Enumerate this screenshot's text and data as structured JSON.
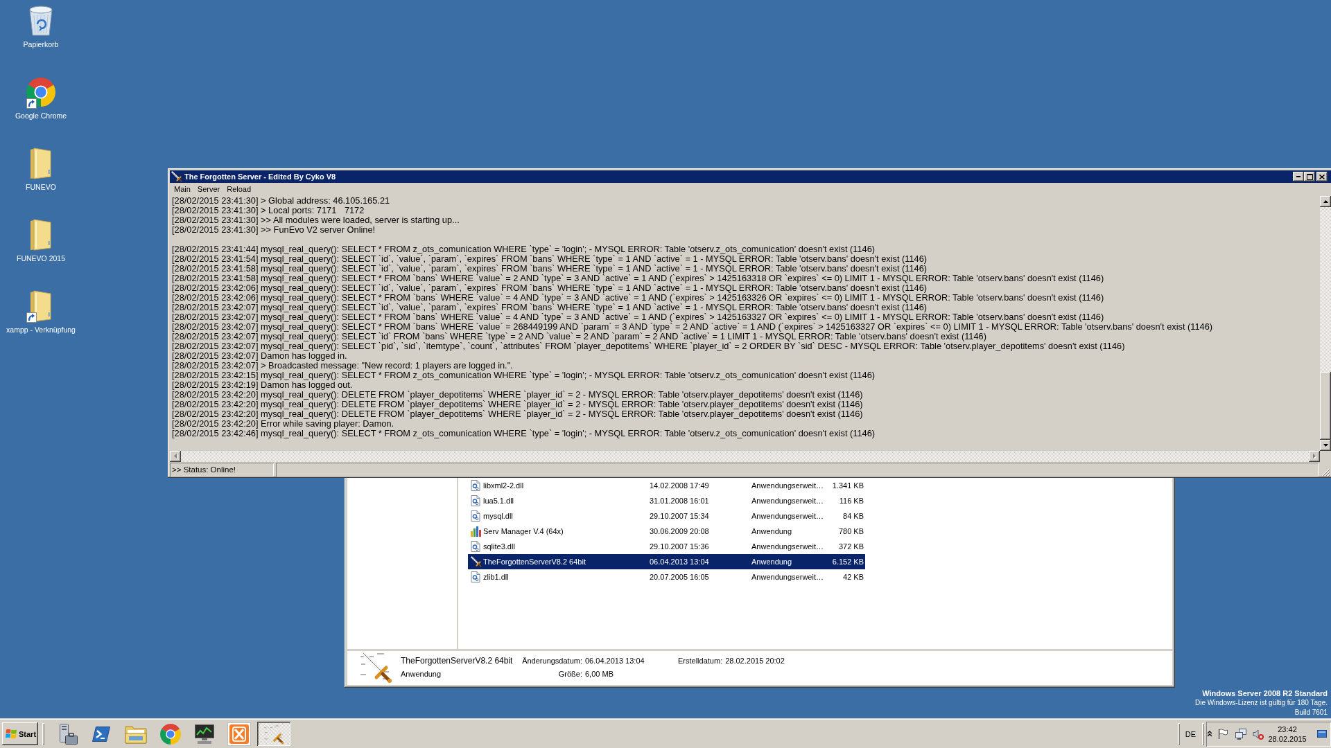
{
  "desktop": {
    "icons": [
      {
        "label": "Papierkorb",
        "kind": "recycle-bin",
        "shortcut": false
      },
      {
        "label": "Google Chrome",
        "kind": "browser",
        "shortcut": true
      },
      {
        "label": "FUNEVO",
        "kind": "folder",
        "shortcut": false
      },
      {
        "label": "FUNEVO 2015",
        "kind": "folder",
        "shortcut": false
      },
      {
        "label": "xampp - Verknüpfung",
        "kind": "folder",
        "shortcut": true
      }
    ]
  },
  "server_window": {
    "title": "The Forgotten Server - Edited By Cyko V8",
    "menu": [
      "Main",
      "Server",
      "Reload"
    ],
    "log": [
      [
        "[28/02/2015 23:41:30] > Global address: 46.105.165.21",
        "[28/02/2015 23:41:30] > Local ports: 7171\t7172",
        "[28/02/2015 23:41:30] >> All modules were loaded, server is starting up...",
        "[28/02/2015 23:41:30] >> FunEvo V2 server Online!"
      ],
      [
        "[28/02/2015 23:41:44] mysql_real_query(): SELECT * FROM z_ots_comunication WHERE `type` = 'login'; - MYSQL ERROR: Table 'otserv.z_ots_comunication' doesn't exist (1146)",
        "[28/02/2015 23:41:54] mysql_real_query(): SELECT `id`, `value`, `param`, `expires` FROM `bans` WHERE `type` = 1 AND `active` = 1 - MYSQL ERROR: Table 'otserv.bans' doesn't exist (1146)",
        "[28/02/2015 23:41:58] mysql_real_query(): SELECT `id`, `value`, `param`, `expires` FROM `bans` WHERE `type` = 1 AND `active` = 1 - MYSQL ERROR: Table 'otserv.bans' doesn't exist (1146)",
        "[28/02/2015 23:41:58] mysql_real_query(): SELECT * FROM `bans` WHERE `value` = 2 AND `type` = 3 AND `active` = 1 AND (`expires` > 1425163318 OR `expires` <= 0) LIMIT 1 - MYSQL ERROR: Table 'otserv.bans' doesn't exist (1146)",
        "[28/02/2015 23:42:06] mysql_real_query(): SELECT `id`, `value`, `param`, `expires` FROM `bans` WHERE `type` = 1 AND `active` = 1 - MYSQL ERROR: Table 'otserv.bans' doesn't exist (1146)",
        "[28/02/2015 23:42:06] mysql_real_query(): SELECT * FROM `bans` WHERE `value` = 4 AND `type` = 3 AND `active` = 1 AND (`expires` > 1425163326 OR `expires` <= 0) LIMIT 1 - MYSQL ERROR: Table 'otserv.bans' doesn't exist (1146)",
        "[28/02/2015 23:42:07] mysql_real_query(): SELECT `id`, `value`, `param`, `expires` FROM `bans` WHERE `type` = 1 AND `active` = 1 - MYSQL ERROR: Table 'otserv.bans' doesn't exist (1146)",
        "[28/02/2015 23:42:07] mysql_real_query(): SELECT * FROM `bans` WHERE `value` = 4 AND `type` = 3 AND `active` = 1 AND (`expires` > 1425163327 OR `expires` <= 0) LIMIT 1 - MYSQL ERROR: Table 'otserv.bans' doesn't exist (1146)",
        "[28/02/2015 23:42:07] mysql_real_query(): SELECT * FROM `bans` WHERE `value` = 268449199 AND `param` = 3 AND `type` = 2 AND `active` = 1 AND (`expires` > 1425163327 OR `expires` <= 0) LIMIT 1 - MYSQL ERROR: Table 'otserv.bans' doesn't exist (1146)",
        "[28/02/2015 23:42:07] mysql_real_query(): SELECT `id` FROM `bans` WHERE `type` = 2 AND `value` = 2 AND `param` = 2 AND `active` = 1 LIMIT 1 - MYSQL ERROR: Table 'otserv.bans' doesn't exist (1146)",
        "[28/02/2015 23:42:07] mysql_real_query(): SELECT `pid`, `sid`, `itemtype`, `count`, `attributes` FROM `player_depotitems` WHERE `player_id` = 2 ORDER BY `sid` DESC - MYSQL ERROR: Table 'otserv.player_depotitems' doesn't exist (1146)",
        "[28/02/2015 23:42:07] Damon has logged in.",
        "[28/02/2015 23:42:07] > Broadcasted message: \"New record: 1 players are logged in.\".",
        "[28/02/2015 23:42:15] mysql_real_query(): SELECT * FROM z_ots_comunication WHERE `type` = 'login'; - MYSQL ERROR: Table 'otserv.z_ots_comunication' doesn't exist (1146)",
        "[28/02/2015 23:42:19] Damon has logged out.",
        "[28/02/2015 23:42:20] mysql_real_query(): DELETE FROM `player_depotitems` WHERE `player_id` = 2 - MYSQL ERROR: Table 'otserv.player_depotitems' doesn't exist (1146)",
        "[28/02/2015 23:42:20] mysql_real_query(): DELETE FROM `player_depotitems` WHERE `player_id` = 2 - MYSQL ERROR: Table 'otserv.player_depotitems' doesn't exist (1146)",
        "[28/02/2015 23:42:20] mysql_real_query(): DELETE FROM `player_depotitems` WHERE `player_id` = 2 - MYSQL ERROR: Table 'otserv.player_depotitems' doesn't exist (1146)",
        "[28/02/2015 23:42:20] Error while saving player: Damon.",
        "[28/02/2015 23:42:46] mysql_real_query(): SELECT * FROM z_ots_comunication WHERE `type` = 'login'; - MYSQL ERROR: Table 'otserv.z_ots_comunication' doesn't exist (1146)"
      ]
    ],
    "status_bar": ">> Status: Online!"
  },
  "explorer": {
    "files": [
      {
        "name": "libxml2-2.dll",
        "date": "14.02.2008 17:49",
        "type": "Anwendungserweit…",
        "size": "1.341 KB",
        "kind": "library",
        "selected": false
      },
      {
        "name": "lua5.1.dll",
        "date": "31.01.2008 16:01",
        "type": "Anwendungserweit…",
        "size": "116 KB",
        "kind": "library",
        "selected": false
      },
      {
        "name": "mysql.dll",
        "date": "29.10.2007 15:34",
        "type": "Anwendungserweit…",
        "size": "84 KB",
        "kind": "library",
        "selected": false
      },
      {
        "name": "Serv Manager V.4 (64x)",
        "date": "30.06.2009 20:08",
        "type": "Anwendung",
        "size": "780 KB",
        "kind": "tool",
        "selected": false
      },
      {
        "name": "sqlite3.dll",
        "date": "29.10.2007 15:36",
        "type": "Anwendungserweit…",
        "size": "372 KB",
        "kind": "library",
        "selected": false
      },
      {
        "name": "TheForgottenServerV8.2 64bit",
        "date": "06.04.2013 13:04",
        "type": "Anwendung",
        "size": "6.152 KB",
        "kind": "server",
        "selected": true
      },
      {
        "name": "zlib1.dll",
        "date": "20.07.2005 16:05",
        "type": "Anwendungserweit…",
        "size": "42 KB",
        "kind": "library",
        "selected": false
      }
    ],
    "details": {
      "name": "TheForgottenServerV8.2 64bit",
      "type": "Anwendung",
      "properties": [
        [
          {
            "label": "Änderungsdatum:",
            "value": "06.04.2013 13:04"
          },
          {
            "label": "Erstelldatum:",
            "value": "28.02.2015 20:02"
          }
        ],
        [
          {
            "label": "Größe:",
            "value": "6,00 MB"
          }
        ]
      ]
    }
  },
  "os_notice": {
    "edition": "Windows Server 2008 R2 Standard",
    "license": "Die Windows-Lizenz ist gültig für 180 Tage.",
    "build": "Build 7601"
  },
  "taskbar": {
    "start": "Start",
    "tasks": [
      {
        "active": true
      }
    ],
    "language": "DE",
    "clock": {
      "time": "23:42",
      "date": "28.02.2015"
    }
  }
}
